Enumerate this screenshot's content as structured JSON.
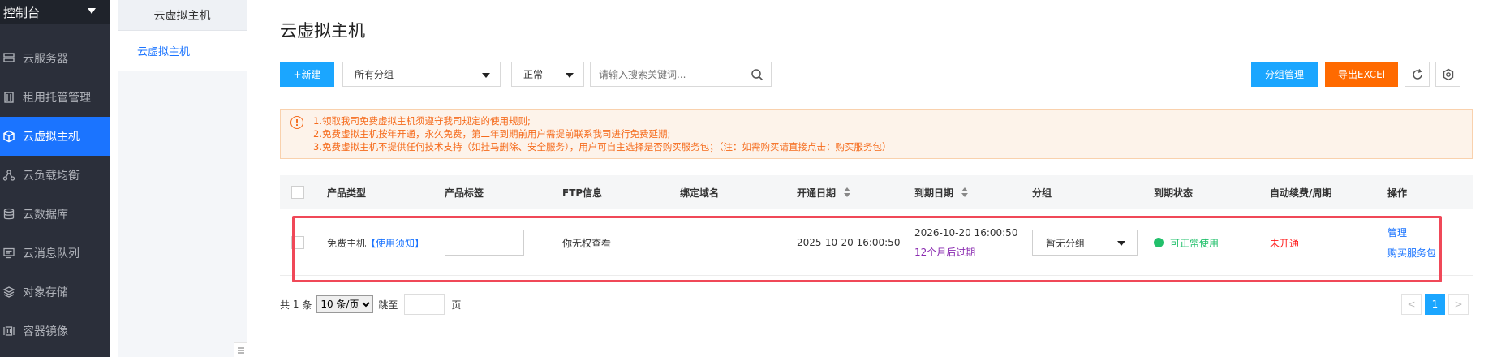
{
  "sidebar": {
    "title": "控制台",
    "items": [
      {
        "label": "云服务器",
        "icon": "server-icon"
      },
      {
        "label": "租用托管管理",
        "icon": "rack-icon"
      },
      {
        "label": "云虚拟主机",
        "icon": "cube-icon",
        "active": true
      },
      {
        "label": "云负载均衡",
        "icon": "load-balance-icon"
      },
      {
        "label": "云数据库",
        "icon": "database-icon"
      },
      {
        "label": "云消息队列",
        "icon": "message-queue-icon"
      },
      {
        "label": "对象存储",
        "icon": "layers-icon"
      },
      {
        "label": "容器镜像",
        "icon": "container-icon"
      }
    ]
  },
  "subnav": {
    "title": "云虚拟主机",
    "items": [
      {
        "label": "云虚拟主机"
      }
    ]
  },
  "main": {
    "title": "云虚拟主机",
    "toolbar": {
      "new_label": "+新建",
      "group_select": "所有分组",
      "status_select": "正常",
      "search_placeholder": "请输入搜索关键词...",
      "group_manage_label": "分组管理",
      "export_label": "导出EXCEl"
    },
    "notice": {
      "lines": [
        "1.领取我司免费虚拟主机须遵守我司规定的使用规则;",
        "2.免费虚拟主机按年开通，永久免费，第二年到期前用户需提前联系我司进行免费延期;",
        "3.免费虚拟主机不提供任何技术支持（如挂马删除、安全服务），用户可自主选择是否购买服务包；（注：如需购买请直接点击：购买服务包）"
      ]
    },
    "table": {
      "headers": [
        "产品类型",
        "产品标签",
        "FTP信息",
        "绑定域名",
        "开通日期",
        "到期日期",
        "分组",
        "到期状态",
        "自动续费/周期",
        "操作"
      ],
      "rows": [
        {
          "product_type": "免费主机",
          "notice_link": "【使用须知】",
          "tag": "",
          "ftp": "你无权查看",
          "domain": "",
          "open_date": "2025-10-20 16:00:50",
          "expire_date": "2026-10-20 16:00:50",
          "expire_relative": "12个月后过期",
          "group": "暂无分组",
          "status": "可正常使用",
          "renew": "未开通",
          "actions": [
            "管理",
            "购买服务包"
          ]
        }
      ]
    },
    "pagination": {
      "total_prefix": "共",
      "total": "1",
      "total_suffix": "条",
      "page_size": "10 条/页",
      "jump_label": "跳至",
      "page_unit": "页",
      "prev": "<",
      "current": "1",
      "next": ">"
    }
  },
  "colors": {
    "primary": "#1ba6ff",
    "active_nav": "#1b74ff",
    "export": "#ff6a00",
    "notice_text": "#f56b1c",
    "status_ok": "#22c06b",
    "renew_off": "#ff1a1a",
    "highlight": "#f04858"
  }
}
